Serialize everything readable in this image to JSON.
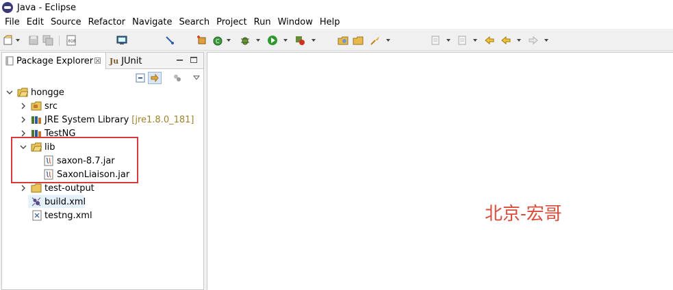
{
  "window": {
    "title": "Java - Eclipse"
  },
  "menu": [
    "File",
    "Edit",
    "Source",
    "Refactor",
    "Navigate",
    "Search",
    "Project",
    "Run",
    "Window",
    "Help"
  ],
  "tabs": {
    "package_explorer": "Package Explorer",
    "package_explorer_close": "☒",
    "junit_glyph": "Ju",
    "junit": "JUnit"
  },
  "tree": {
    "project": "hongge",
    "src": "src",
    "jre": "JRE System Library",
    "jre_version": "[jre1.8.0_181]",
    "testng": "TestNG",
    "lib": "lib",
    "saxon": "saxon-8.7.jar",
    "saxon_liaison": "SaxonLiaison.jar",
    "test_output": "test-output",
    "build_xml": "build.xml",
    "testng_xml": "testng.xml"
  },
  "watermark": "北京-宏哥",
  "colors": {
    "highlight": "#d83a3a",
    "watermark": "#d94b3a",
    "selection": "#e5f1fb"
  }
}
